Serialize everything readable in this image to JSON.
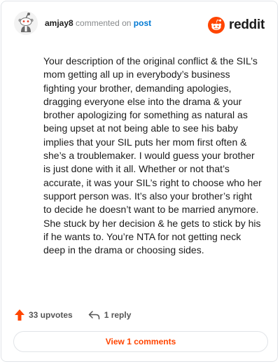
{
  "header": {
    "username": "amjay8",
    "action_text": "commented on",
    "post_link_text": "post"
  },
  "brand": {
    "wordmark": "reddit",
    "logo_icon": "reddit-alien-icon",
    "color": "#ff4500"
  },
  "comment": {
    "body": "Your description of the original conflict & the SIL’s mom getting all up in everybody’s business fighting your brother, demanding apologies, dragging everyone else into the drama & your brother apologizing for something as natural as being upset at not being able to see his baby implies that your SIL puts her mom first often & she’s a troublemaker. I would guess your brother is just done with it all. Whether or not that’s accurate, it was your SIL’s right to choose who her support person was. It’s also your brother’s right to decide he doesn’t want to be married anymore. She stuck by her decision & he gets to stick by his if he wants to. You’re NTA for not getting neck deep in the drama or choosing sides."
  },
  "footer": {
    "upvotes_label": "33 upvotes",
    "replies_label": "1 reply",
    "upvote_icon": "upvote-arrow-icon",
    "reply_icon": "reply-arrow-icon",
    "upvote_color": "#ff4500"
  },
  "view_comments_button": {
    "label": "View 1 comments"
  }
}
